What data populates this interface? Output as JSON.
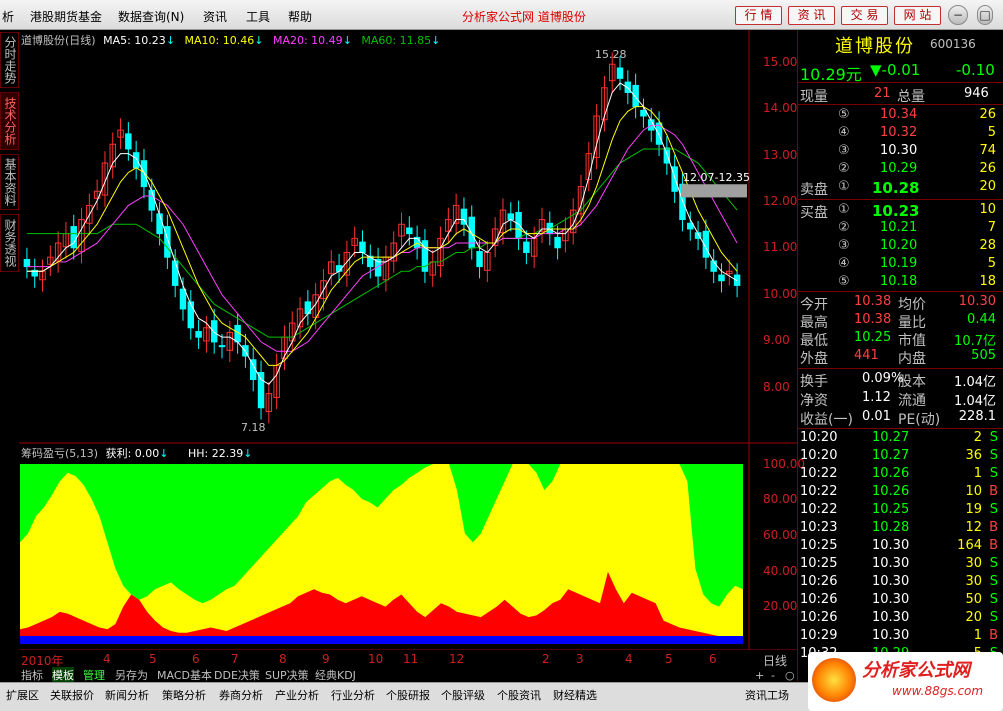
{
  "menu": {
    "items": [
      "析",
      "港股期货基金",
      "数据查询(N)",
      "资讯",
      "工具",
      "帮助"
    ],
    "center_title": "分析家公式网 道博股份",
    "buttons": [
      "行 情",
      "资 讯",
      "交 易",
      "网 站"
    ],
    "window_controls": [
      "−",
      "□",
      "×"
    ]
  },
  "side_tabs": [
    "分时走势",
    "技术分析",
    "基本资料",
    "财务透视"
  ],
  "main_legend": {
    "title": "道博股份(日线)",
    "ma5": "MA5: 10.23",
    "ma10": "MA10: 10.46",
    "ma20": "MA20: 10.49",
    "ma60": "MA60: 11.85",
    "arrow": "↓"
  },
  "sub_legend": {
    "title": "筹码盈亏(5,13)",
    "profit": "获利: 0.00",
    "hh": "HH: 22.39",
    "arrow": "↓"
  },
  "annotations": {
    "high": "15.28",
    "low": "7.18",
    "range_label": "12.07-12.35"
  },
  "colors": {
    "up": "#ff3030",
    "down": "#00ffff",
    "ma5": "#ffffff",
    "ma10": "#ffff00",
    "ma20": "#ff40ff",
    "ma60": "#00c000",
    "green_area": "#00ff00",
    "yellow_area": "#ffff00",
    "red_area": "#ff0000",
    "blue_band": "#0000ff"
  },
  "chart_data": [
    {
      "type": "candlestick",
      "title": "道博股份(日线)",
      "y_axis_ticks": [
        "15.00",
        "14.00",
        "13.00",
        "12.00",
        "11.00",
        "10.00",
        "9.00",
        "8.00"
      ],
      "ylim": [
        7.0,
        15.5
      ],
      "x_ticks": [
        "2010年",
        "4",
        "5",
        "6",
        "7",
        "8",
        "9",
        "10",
        "11",
        "12",
        "2",
        "3",
        "4",
        "5",
        "6"
      ],
      "period_label": "日线",
      "close_series": [
        10.6,
        10.4,
        10.5,
        10.8,
        11.1,
        11.3,
        11.0,
        11.6,
        11.9,
        12.2,
        12.8,
        13.2,
        13.5,
        13.1,
        12.7,
        12.3,
        11.8,
        11.3,
        10.8,
        10.2,
        9.7,
        9.3,
        9.1,
        9.3,
        9.0,
        8.9,
        9.2,
        9.0,
        8.7,
        8.2,
        7.6,
        7.9,
        8.5,
        9.1,
        9.4,
        9.7,
        9.6,
        10.0,
        10.3,
        10.7,
        10.5,
        10.9,
        11.2,
        10.9,
        10.6,
        10.4,
        10.8,
        11.1,
        11.5,
        11.3,
        11.0,
        10.5,
        10.7,
        11.2,
        11.6,
        11.9,
        11.5,
        11.0,
        10.6,
        10.9,
        11.4,
        11.8,
        11.6,
        11.2,
        10.9,
        11.2,
        11.6,
        11.3,
        11.0,
        11.4,
        11.8,
        12.3,
        13.0,
        13.8,
        14.4,
        14.9,
        14.6,
        14.3,
        14.0,
        13.8,
        13.5,
        13.2,
        12.8,
        12.2,
        11.6,
        11.4,
        11.2,
        10.8,
        10.5,
        10.3,
        10.5,
        10.2
      ],
      "ma5": [
        10.5,
        10.5,
        10.5,
        10.6,
        10.8,
        11.0,
        11.1,
        11.4,
        11.7,
        12.0,
        12.4,
        12.8,
        13.0,
        13.0,
        12.9,
        12.6,
        12.2,
        11.7,
        11.2,
        10.7,
        10.2,
        9.8,
        9.5,
        9.4,
        9.2,
        9.1,
        9.1,
        9.0,
        8.8,
        8.5,
        8.2,
        8.1,
        8.3,
        8.7,
        9.0,
        9.4,
        9.6,
        9.8,
        10.1,
        10.4,
        10.5,
        10.7,
        10.9,
        10.9,
        10.8,
        10.7,
        10.7,
        10.8,
        11.0,
        11.2,
        11.2,
        11.0,
        10.9,
        11.0,
        11.3,
        11.6,
        11.6,
        11.3,
        11.0,
        10.9,
        11.1,
        11.5,
        11.6,
        11.5,
        11.3,
        11.2,
        11.4,
        11.4,
        11.3,
        11.3,
        11.5,
        11.9,
        12.5,
        13.2,
        13.8,
        14.3,
        14.5,
        14.4,
        14.2,
        14.0,
        13.7,
        13.4,
        13.0,
        12.5,
        12.0,
        11.6,
        11.3,
        11.0,
        10.7,
        10.5,
        10.4,
        10.3
      ],
      "ma10": [
        10.5,
        10.5,
        10.5,
        10.6,
        10.7,
        10.8,
        10.9,
        11.1,
        11.3,
        11.5,
        11.8,
        12.1,
        12.4,
        12.6,
        12.7,
        12.6,
        12.4,
        12.1,
        11.8,
        11.4,
        11.0,
        10.6,
        10.2,
        9.9,
        9.6,
        9.4,
        9.3,
        9.2,
        9.1,
        8.9,
        8.7,
        8.5,
        8.5,
        8.6,
        8.8,
        9.0,
        9.2,
        9.5,
        9.8,
        10.1,
        10.3,
        10.5,
        10.7,
        10.8,
        10.8,
        10.8,
        10.8,
        10.8,
        10.9,
        11.0,
        11.1,
        11.0,
        11.0,
        11.0,
        11.1,
        11.3,
        11.4,
        11.3,
        11.2,
        11.1,
        11.1,
        11.3,
        11.4,
        11.4,
        11.3,
        11.3,
        11.3,
        11.4,
        11.4,
        11.4,
        11.4,
        11.6,
        11.9,
        12.3,
        12.8,
        13.3,
        13.7,
        13.9,
        14.0,
        14.0,
        13.9,
        13.7,
        13.4,
        13.0,
        12.6,
        12.2,
        11.8,
        11.5,
        11.2,
        10.9,
        10.7,
        10.5
      ],
      "ma20": [
        10.6,
        10.6,
        10.6,
        10.6,
        10.7,
        10.7,
        10.8,
        10.9,
        11.0,
        11.1,
        11.3,
        11.5,
        11.7,
        11.9,
        12.0,
        12.1,
        12.1,
        12.0,
        11.9,
        11.7,
        11.5,
        11.2,
        10.9,
        10.6,
        10.3,
        10.0,
        9.8,
        9.6,
        9.4,
        9.2,
        9.0,
        8.9,
        8.8,
        8.8,
        8.8,
        8.9,
        9.0,
        9.2,
        9.4,
        9.6,
        9.8,
        10.0,
        10.2,
        10.4,
        10.5,
        10.6,
        10.7,
        10.8,
        10.9,
        10.9,
        11.0,
        11.0,
        11.0,
        11.0,
        11.0,
        11.1,
        11.1,
        11.1,
        11.1,
        11.1,
        11.1,
        11.2,
        11.2,
        11.2,
        11.2,
        11.2,
        11.3,
        11.3,
        11.3,
        11.4,
        11.4,
        11.5,
        11.7,
        11.9,
        12.2,
        12.5,
        12.8,
        13.1,
        13.3,
        13.5,
        13.6,
        13.6,
        13.5,
        13.4,
        13.2,
        12.9,
        12.6,
        12.3,
        12.0,
        11.7,
        11.4,
        11.1
      ],
      "ma60": [
        11.3,
        11.3,
        11.3,
        11.3,
        11.3,
        11.3,
        11.3,
        11.3,
        11.3,
        11.3,
        11.4,
        11.5,
        11.5,
        11.5,
        11.5,
        11.4,
        11.3,
        11.2,
        11.0,
        10.8,
        10.6,
        10.4,
        10.2,
        10.0,
        9.8,
        9.7,
        9.6,
        9.5,
        9.4,
        9.3,
        9.2,
        9.1,
        9.1,
        9.1,
        9.1,
        9.2,
        9.3,
        9.4,
        9.5,
        9.6,
        9.7,
        9.8,
        9.9,
        10.0,
        10.1,
        10.2,
        10.3,
        10.4,
        10.5,
        10.5,
        10.6,
        10.6,
        10.7,
        10.7,
        10.8,
        10.9,
        10.9,
        11.0,
        11.0,
        11.1,
        11.1,
        11.2,
        11.2,
        11.2,
        11.3,
        11.3,
        11.4,
        11.4,
        11.5,
        11.6,
        11.7,
        11.8,
        12.0,
        12.2,
        12.4,
        12.6,
        12.8,
        12.9,
        13.0,
        13.1,
        13.1,
        13.1,
        13.1,
        13.1,
        13.0,
        12.9,
        12.8,
        12.6,
        12.4,
        12.2,
        12.0,
        11.8
      ]
    },
    {
      "type": "area",
      "title": "筹码盈亏(5,13)",
      "y_axis_ticks": [
        "100.00",
        "80.00",
        "60.00",
        "40.00",
        "20.00"
      ],
      "ylim": [
        0,
        100
      ],
      "yellow_top": [
        55,
        60,
        70,
        75,
        82,
        90,
        95,
        93,
        88,
        80,
        70,
        55,
        40,
        30,
        25,
        22,
        24,
        28,
        30,
        32,
        28,
        25,
        22,
        20,
        22,
        25,
        28,
        30,
        35,
        40,
        45,
        50,
        55,
        60,
        65,
        70,
        78,
        82,
        86,
        90,
        92,
        88,
        85,
        80,
        78,
        75,
        80,
        85,
        88,
        92,
        95,
        98,
        100,
        100,
        100,
        85,
        60,
        55,
        60,
        70,
        80,
        90,
        100,
        100,
        100,
        95,
        85,
        90,
        100,
        100,
        100,
        100,
        100,
        100,
        100,
        100,
        100,
        100,
        100,
        100,
        100,
        100,
        100,
        100,
        90,
        40,
        25,
        20,
        18,
        25,
        30,
        28
      ],
      "red_top": [
        5,
        6,
        8,
        10,
        12,
        15,
        14,
        12,
        10,
        8,
        6,
        5,
        8,
        18,
        25,
        22,
        15,
        10,
        6,
        4,
        3,
        3,
        4,
        5,
        6,
        5,
        4,
        6,
        8,
        10,
        12,
        14,
        16,
        18,
        20,
        24,
        26,
        28,
        26,
        25,
        22,
        20,
        22,
        24,
        22,
        20,
        18,
        22,
        25,
        20,
        15,
        12,
        16,
        20,
        18,
        15,
        14,
        13,
        12,
        15,
        18,
        22,
        18,
        14,
        12,
        13,
        16,
        20,
        22,
        28,
        26,
        24,
        22,
        20,
        38,
        28,
        20,
        26,
        24,
        22,
        20,
        10,
        8,
        6,
        5,
        4,
        3,
        2,
        1,
        1,
        0,
        0
      ]
    }
  ],
  "quote": {
    "name": "道博股份",
    "code": "600136",
    "price": "10.29元",
    "change": "▼-0.01",
    "change2": "-0.10",
    "vol_label": "现量",
    "vol_value": "21",
    "total_label": "总量",
    "total_value": "946",
    "sell_label": "卖盘",
    "buy_label": "买盘",
    "sells": [
      {
        "idx": "⑤",
        "price": "10.34",
        "vol": "26"
      },
      {
        "idx": "④",
        "price": "10.32",
        "vol": "5"
      },
      {
        "idx": "③",
        "price": "10.30",
        "vol": "74"
      },
      {
        "idx": "②",
        "price": "10.29",
        "vol": "26"
      },
      {
        "idx": "①",
        "price": "10.28",
        "vol": "20"
      }
    ],
    "buys": [
      {
        "idx": "①",
        "price": "10.23",
        "vol": "10"
      },
      {
        "idx": "②",
        "price": "10.21",
        "vol": "7"
      },
      {
        "idx": "③",
        "price": "10.20",
        "vol": "28"
      },
      {
        "idx": "④",
        "price": "10.19",
        "vol": "5"
      },
      {
        "idx": "⑤",
        "price": "10.18",
        "vol": "18"
      }
    ],
    "stats": [
      {
        "l1": "今开",
        "v1": "10.38",
        "l2": "均价",
        "v2": "10.30"
      },
      {
        "l1": "最高",
        "v1": "10.38",
        "l2": "量比",
        "v2": "0.44"
      },
      {
        "l1": "最低",
        "v1": "10.25",
        "l2": "市值",
        "v2": "10.7亿"
      },
      {
        "l1": "外盘",
        "v1": "441",
        "l2": "内盘",
        "v2": "505"
      }
    ],
    "stats2": [
      {
        "l1": "换手",
        "v1": "0.09%",
        "l2": "股本",
        "v2": "1.04亿"
      },
      {
        "l1": "净资",
        "v1": "1.12",
        "l2": "流通",
        "v2": "1.04亿"
      },
      {
        "l1": "收益(一)",
        "v1": "0.01",
        "l2": "PE(动)",
        "v2": "228.1"
      }
    ],
    "ticks": [
      {
        "t": "10:20",
        "p": "10.27",
        "v": "2",
        "s": "S"
      },
      {
        "t": "10:20",
        "p": "10.27",
        "v": "36",
        "s": "S"
      },
      {
        "t": "10:22",
        "p": "10.26",
        "v": "1",
        "s": "S"
      },
      {
        "t": "10:22",
        "p": "10.26",
        "v": "10",
        "s": "B"
      },
      {
        "t": "10:22",
        "p": "10.25",
        "v": "19",
        "s": "S"
      },
      {
        "t": "10:23",
        "p": "10.28",
        "v": "12",
        "s": "B"
      },
      {
        "t": "10:25",
        "p": "10.30",
        "v": "164",
        "s": "B"
      },
      {
        "t": "10:25",
        "p": "10.30",
        "v": "30",
        "s": "S"
      },
      {
        "t": "10:26",
        "p": "10.30",
        "v": "30",
        "s": "S"
      },
      {
        "t": "10:26",
        "p": "10.30",
        "v": "50",
        "s": "S"
      },
      {
        "t": "10:26",
        "p": "10.30",
        "v": "20",
        "s": "S"
      },
      {
        "t": "10:29",
        "p": "10.30",
        "v": "1",
        "s": "B"
      },
      {
        "t": "10:32",
        "p": "10.29",
        "v": "5",
        "s": "S"
      }
    ]
  },
  "bottom_tabs": [
    "指标",
    "模板",
    "管理",
    "另存为",
    "MACD基本",
    "DDE决策",
    "SUP决策",
    "经典KDJ"
  ],
  "bottom_controls": [
    "+",
    "-",
    "○"
  ],
  "status_items": [
    "扩展区",
    "关联报价",
    "新闻分析",
    "策略分析",
    "券商分析",
    "产业分析",
    "行业分析",
    "个股研报",
    "个股评级",
    "个股资讯",
    "财经精选",
    "资讯工场"
  ],
  "watermark": {
    "text": "分析家公式网",
    "url": "www.88gs.com"
  }
}
